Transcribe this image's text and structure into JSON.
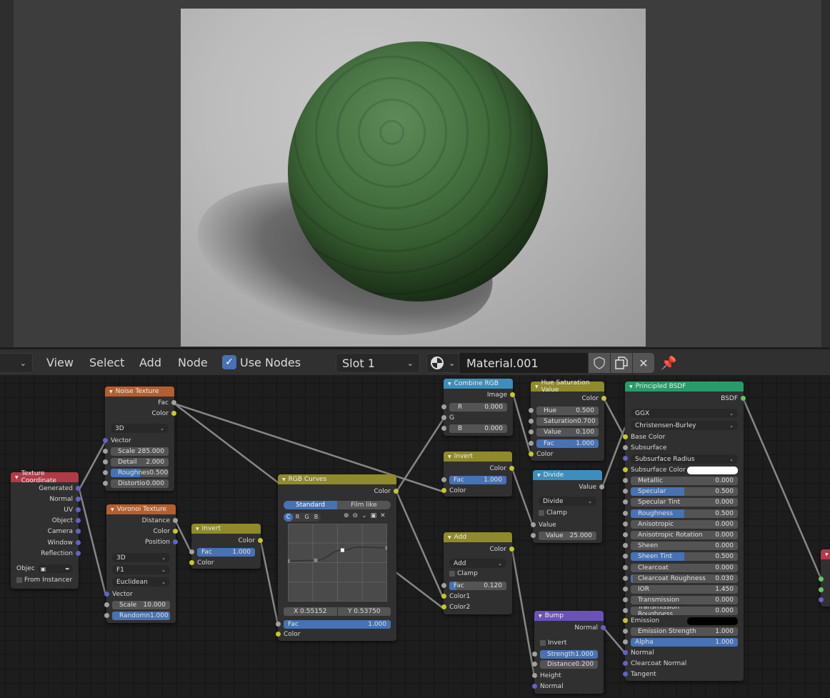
{
  "header": {
    "editor_dropdown": "",
    "menus": [
      "View",
      "Select",
      "Add",
      "Node"
    ],
    "use_nodes_label": "Use Nodes",
    "use_nodes_checked": true,
    "slot": "Slot 1",
    "material_name": "Material.001",
    "icons": {
      "material_type": "material-sphere-icon",
      "fake_user": "shield-icon",
      "duplicate": "duplicate-icon",
      "unlink": "close-icon",
      "pin": "pin-icon"
    }
  },
  "viewport": {
    "subject": "green scaly sphere render"
  },
  "colors": {
    "accent": "#4772b3",
    "input_node": "#b13a48",
    "texture_node": "#b45f2f",
    "color_node": "#8f8a2b",
    "converter_node": "#3c8fbd",
    "vector_node": "#6a52b8",
    "shader_node": "#2a9a68",
    "socket_color": "#c7c729",
    "socket_vector": "#6363c7",
    "socket_float": "#a1a1a1",
    "socket_shader": "#63c763"
  },
  "nodes": {
    "texcoord": {
      "title": "Texture Coordinate",
      "outputs": [
        "Generated",
        "Normal",
        "UV",
        "Object",
        "Camera",
        "Window",
        "Reflection"
      ],
      "object_label": "Objec",
      "from_instancer": "From Instancer"
    },
    "noise": {
      "title": "Noise Texture",
      "outputs": [
        "Fac",
        "Color"
      ],
      "dimension": "3D",
      "vector": "Vector",
      "fields": [
        {
          "label": "Scale",
          "value": "285.000",
          "fill": 0
        },
        {
          "label": "Detail",
          "value": "2.000",
          "fill": 0
        },
        {
          "label": "Roughnes",
          "value": "0.500",
          "fill": 0.5
        },
        {
          "label": "Distortio",
          "value": "0.000",
          "fill": 0
        }
      ]
    },
    "voronoi": {
      "title": "Voronoi Texture",
      "outputs": [
        "Distance",
        "Color",
        "Position"
      ],
      "dimension": "3D",
      "feature": "F1",
      "metric": "Euclidean",
      "vector": "Vector",
      "fields": [
        {
          "label": "Scale",
          "value": "10.000",
          "fill": 0
        },
        {
          "label": "Randomn",
          "value": "1.000",
          "fill": 1
        }
      ]
    },
    "invert1": {
      "title": "Invert",
      "output": "Color",
      "fac_label": "Fac",
      "fac_value": "1.000",
      "fac_fill": 1,
      "color": "Color"
    },
    "curves": {
      "title": "RGB Curves",
      "output": "Color",
      "tabs": [
        "Standard",
        "Film like"
      ],
      "channels": [
        "C",
        "R",
        "G",
        "B"
      ],
      "x_readout": "X 0.55152",
      "y_readout": "Y 0.53750",
      "fac_label": "Fac",
      "fac_value": "1.000",
      "fac_fill": 1,
      "color": "Color",
      "curve_points": [
        [
          0,
          0.52
        ],
        [
          0.28,
          0.53
        ],
        [
          0.55,
          0.66
        ],
        [
          0.72,
          0.7
        ],
        [
          1,
          0.69
        ]
      ]
    },
    "combine": {
      "title": "Combine RGB",
      "output": "Image",
      "fields": [
        {
          "label": "R",
          "value": "0.000"
        },
        {
          "label": "G",
          "value": ""
        },
        {
          "label": "B",
          "value": "0.000"
        }
      ]
    },
    "invert2": {
      "title": "Invert",
      "output": "Color",
      "fac_label": "Fac",
      "fac_value": "1.000",
      "fac_fill": 1,
      "color": "Color"
    },
    "add": {
      "title": "Add",
      "output": "Color",
      "operation": "Add",
      "clamp": "Clamp",
      "fac_label": "Fac",
      "fac_value": "0.120",
      "fac_fill": 0.12,
      "inputs": [
        "Color1",
        "Color2"
      ]
    },
    "hsv": {
      "title": "Hue Saturation Value",
      "output": "Color",
      "fields": [
        {
          "label": "Hue",
          "value": "0.500",
          "fill": 0
        },
        {
          "label": "Saturation",
          "value": "0.700",
          "fill": 0
        },
        {
          "label": "Value",
          "value": "0.100",
          "fill": 0
        },
        {
          "label": "Fac",
          "value": "1.000",
          "fill": 1
        }
      ],
      "color": "Color"
    },
    "divide": {
      "title": "Divide",
      "output": "Value",
      "operation": "Divide",
      "clamp": "Clamp",
      "input": "Value",
      "value_label": "Value",
      "value_value": "25.000"
    },
    "bump": {
      "title": "Bump",
      "output": "Normal",
      "invert": "Invert",
      "fields": [
        {
          "label": "Strength",
          "value": "1.000",
          "fill": 1
        },
        {
          "label": "Distance",
          "value": "0.200",
          "fill": 0
        }
      ],
      "inputs": [
        "Height",
        "Normal"
      ]
    },
    "bsdf": {
      "title": "Principled BSDF",
      "output": "BSDF",
      "distribution": "GGX",
      "subsurface_method": "Christensen-Burley",
      "base_color": "Base Color",
      "subsurface": "Subsurface",
      "subsurface_radius": "Subsurface Radius",
      "subsurface_color": "Subsurface Color",
      "fields": [
        {
          "label": "Metallic",
          "value": "0.000",
          "fill": 0
        },
        {
          "label": "Specular",
          "value": "0.500",
          "fill": 0.5
        },
        {
          "label": "Specular Tint",
          "value": "0.000",
          "fill": 0
        },
        {
          "label": "Roughness",
          "value": "0.500",
          "fill": 0.5
        },
        {
          "label": "Anisotropic",
          "value": "0.000",
          "fill": 0
        },
        {
          "label": "Anisotropic Rotation",
          "value": "0.000",
          "fill": 0
        },
        {
          "label": "Sheen",
          "value": "0.000",
          "fill": 0
        },
        {
          "label": "Sheen Tint",
          "value": "0.500",
          "fill": 0.5
        },
        {
          "label": "Clearcoat",
          "value": "0.000",
          "fill": 0
        },
        {
          "label": "Clearcoat Roughness",
          "value": "0.030",
          "fill": 0.03
        },
        {
          "label": "IOR",
          "value": "1.450",
          "fill": 0
        },
        {
          "label": "Transmission",
          "value": "0.000",
          "fill": 0
        },
        {
          "label": "Transmission Roughness",
          "value": "0.000",
          "fill": 0
        }
      ],
      "emission": "Emission",
      "emission_strength_label": "Emission Strength",
      "emission_strength": "1.000",
      "alpha_label": "Alpha",
      "alpha": "1.000",
      "alpha_fill": 1,
      "vector_inputs": [
        "Normal",
        "Clearcoat Normal",
        "Tangent"
      ]
    }
  }
}
